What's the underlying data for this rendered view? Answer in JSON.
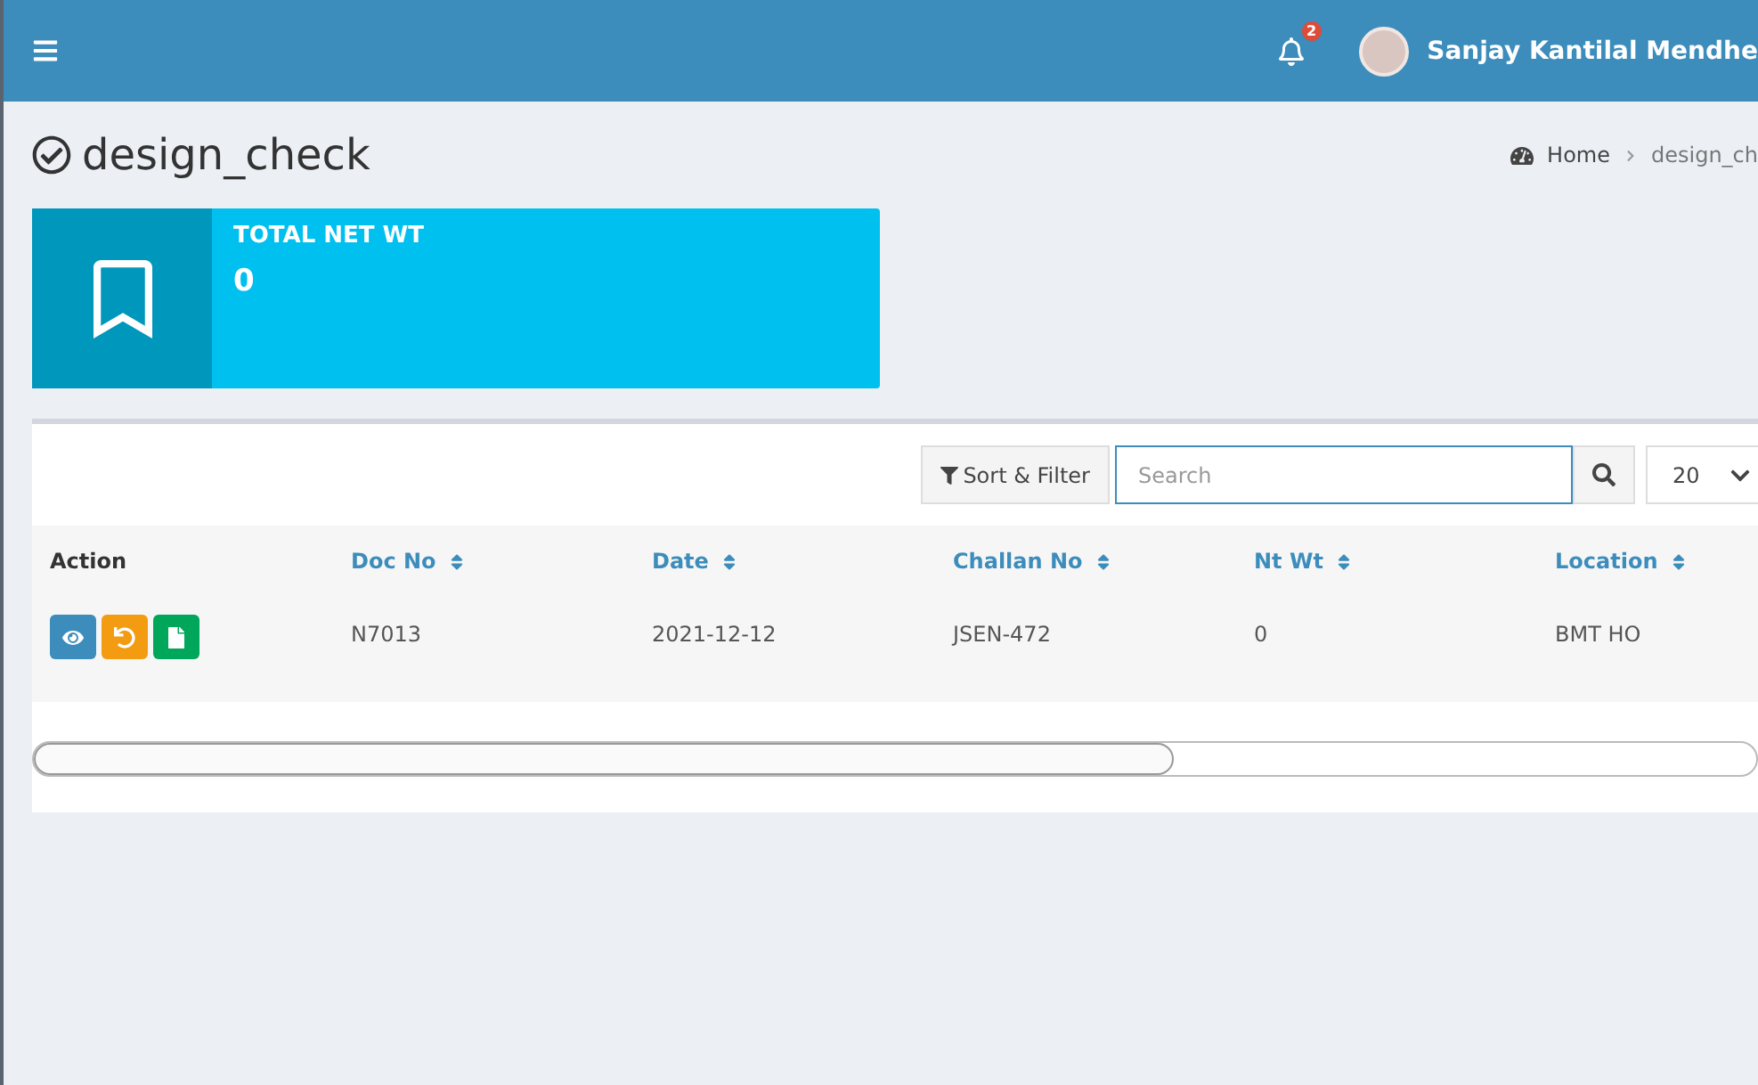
{
  "header": {
    "notification_count": "2",
    "user_name": "Sanjay Kantilal Mendhe"
  },
  "page": {
    "title": "design_check",
    "breadcrumb": [
      "Home",
      "design_ch"
    ]
  },
  "info_box": {
    "label": "TOTAL NET WT",
    "value": "0"
  },
  "toolbar": {
    "sort_filter": "Sort & Filter",
    "search": {
      "placeholder": "Search"
    },
    "page_size": "20"
  },
  "table": {
    "columns": [
      {
        "label": "Action",
        "sortable": false
      },
      {
        "label": "Doc No",
        "sortable": true
      },
      {
        "label": "Date",
        "sortable": true
      },
      {
        "label": "Challan No",
        "sortable": true
      },
      {
        "label": "Nt Wt",
        "sortable": true
      },
      {
        "label": "Location",
        "sortable": true
      }
    ],
    "rows": [
      {
        "cells": [
          {
            "kind": "actions",
            "actions": [
              {
                "kind": "view",
                "color": "#3c8dbc"
              },
              {
                "kind": "revert",
                "color": "#f39c12"
              },
              {
                "kind": "document",
                "color": "#00a65a"
              }
            ]
          },
          {
            "kind": "text",
            "text": "N7013"
          },
          {
            "kind": "text",
            "text": "2021-12-12"
          },
          {
            "kind": "text",
            "text": "JSEN-472"
          },
          {
            "kind": "text",
            "text": "0"
          },
          {
            "kind": "text",
            "text": "BMT HO"
          }
        ]
      }
    ]
  }
}
